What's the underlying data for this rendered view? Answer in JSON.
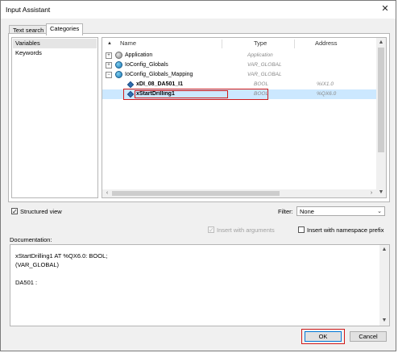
{
  "window": {
    "title": "Input Assistant",
    "close_glyph": "✕"
  },
  "tabs": [
    {
      "label": "Text search"
    },
    {
      "label": "Categories"
    }
  ],
  "categories": [
    {
      "label": "Variables"
    },
    {
      "label": "Keywords"
    }
  ],
  "tree": {
    "headers": {
      "name": "Name",
      "type": "Type",
      "address": "Address"
    },
    "rows": [
      {
        "name": "Application",
        "type": "Application",
        "address": "",
        "icon": "application-icon",
        "expander": "+"
      },
      {
        "name": "IoConfig_Globals",
        "type": "VAR_GLOBAL",
        "address": "",
        "icon": "globe-icon",
        "expander": "+"
      },
      {
        "name": "IoConfig_Globals_Mapping",
        "type": "VAR_GLOBAL",
        "address": "",
        "icon": "globe-icon",
        "expander": "−"
      },
      {
        "name": "xDI_08_DA501_I1",
        "type": "BOOL",
        "address": "%IX1.0",
        "icon": "variable-icon",
        "expander": ""
      },
      {
        "name": "xStartDrilling1",
        "type": "BOOL",
        "address": "%QX6.0",
        "icon": "variable-icon",
        "expander": ""
      }
    ]
  },
  "structured_view": {
    "label": "Structured view",
    "checked": true,
    "check_glyph": "✓"
  },
  "filter": {
    "label": "Filter:",
    "value": "None",
    "arrow": "⌄"
  },
  "insert_with_arguments": {
    "label": "Insert with arguments",
    "checked": true,
    "disabled": true
  },
  "insert_with_namespace_prefix": {
    "label": "Insert with namespace prefix",
    "checked": false
  },
  "documentation": {
    "label": "Documentation:",
    "lines": [
      "xStartDrilling1 AT %QX6.0: BOOL;",
      "(VAR_GLOBAL)",
      "",
      "DA501 :"
    ]
  },
  "buttons": {
    "ok": "OK",
    "cancel": "Cancel"
  },
  "scroll_glyphs": {
    "up": "▲",
    "down": "▼",
    "left": "‹",
    "right": "›",
    "sort_up": "▲"
  },
  "colors": {
    "selection": "#cce8ff",
    "highlight_border": "#d01a1a",
    "default_button_border": "#0078d7"
  }
}
